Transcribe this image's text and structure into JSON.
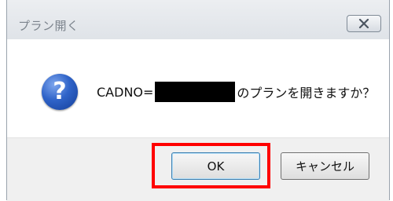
{
  "dialog": {
    "title": "プラン開く",
    "close_icon": "close-x-icon",
    "message_prefix": "CADNO=",
    "message_suffix": "のプランを開きますか？",
    "icon": "question-icon",
    "ok_label": "OK",
    "cancel_label": "キャンセル"
  },
  "colors": {
    "highlight": "#ff0000",
    "icon_blue": "#2f63c8"
  }
}
